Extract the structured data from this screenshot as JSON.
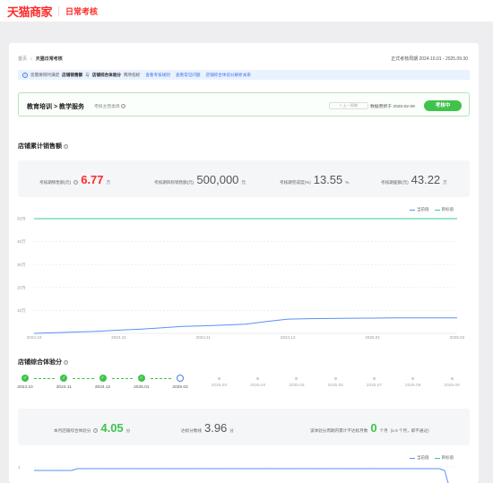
{
  "header": {
    "logo": "天猫商家",
    "section": "日常考核"
  },
  "breadcrumb": {
    "root": "首页",
    "current": "天猫日常考核"
  },
  "period": "正式考核周期 2024.10.01 - 2025.09.30",
  "notice": {
    "text_a": "您需要同时满足",
    "bold_a": "店铺销售额",
    "text_b": "与",
    "bold_b": "店铺综合体验分",
    "text_c": "两项指标",
    "link1": "查看考核规则",
    "link2": "查看常见问题",
    "link3": "店铺综合体验分解析关系"
  },
  "category": {
    "title": "教育培训 > 教学服务",
    "subtitle": "考核主营类目",
    "page_btn": "< 上一周期",
    "updated": "数据更新于 2025-02-09",
    "status": "考核中"
  },
  "sales": {
    "title": "店铺累计销售额",
    "stats": [
      {
        "label": "考核期销售额(元)",
        "value": "6.77",
        "unit": "万"
      },
      {
        "label": "考核期目标销售额(元)",
        "value": "500,000",
        "unit": "元"
      },
      {
        "label": "考核期完成度(%)",
        "value": "13.55",
        "unit": "%"
      },
      {
        "label": "考核期差额(元)",
        "value": "43.22",
        "unit": "万"
      }
    ],
    "legend": [
      "当前值",
      "目标值"
    ]
  },
  "colors": {
    "accent": "#ff2a2a",
    "green": "#3fc34b",
    "blue": "#5b8ff9",
    "teal": "#3cc8a0"
  },
  "chart_data": [
    {
      "type": "line",
      "yticks": [
        "50万",
        "40万",
        "30万",
        "20万",
        "10万"
      ],
      "ylim": [
        0,
        500000
      ],
      "xticks": [
        "2024.10",
        "2024.10",
        "2024.11",
        "2024.12",
        "2025.01",
        "2025.02"
      ],
      "series": [
        {
          "name": "当前值",
          "color": "#5b8ff9",
          "x": [
            0,
            5,
            10,
            15,
            20,
            25,
            30,
            35,
            40,
            45,
            50,
            55,
            60,
            65,
            70,
            75,
            80,
            85,
            90,
            95,
            100
          ],
          "values": [
            0,
            3000,
            6000,
            9000,
            14000,
            18000,
            24000,
            30000,
            33000,
            36000,
            40000,
            52000,
            62000,
            64000,
            65000,
            66000,
            66500,
            67000,
            67200,
            67500,
            67700
          ]
        },
        {
          "name": "目标值",
          "color": "#3cc8a0",
          "x": [
            0,
            100
          ],
          "values": [
            500000,
            500000
          ]
        }
      ]
    },
    {
      "type": "line",
      "yticks": [
        "1"
      ],
      "series": [
        {
          "name": "当前值",
          "color": "#5b8ff9"
        },
        {
          "name": "目标值",
          "color": "#3cc8a0"
        }
      ]
    }
  ],
  "experience": {
    "title": "店铺综合体验分",
    "months": [
      "2024.10",
      "2024.11",
      "2024.12",
      "2025.01",
      "2025.02",
      "2025.03",
      "2025.04",
      "2025.05",
      "2025.06",
      "2025.07",
      "2025.08",
      "2025.09"
    ],
    "status": [
      "done",
      "done",
      "done",
      "done",
      "current",
      "todo",
      "todo",
      "todo",
      "todo",
      "todo",
      "todo",
      "todo"
    ],
    "stats": {
      "s1_label": "本月店铺综合体验分",
      "s1_value": "4.05",
      "s1_unit": "分",
      "s2_label": "达标分数线",
      "s2_value": "3.96",
      "s2_unit": "分",
      "s3_label": "该体验分周期内累计不达标月数",
      "s3_value": "0",
      "s3_unit": "个月",
      "s3_note": "(≥ 6 个月，即不通过)"
    },
    "legend": [
      "当前值",
      "目标值"
    ]
  }
}
